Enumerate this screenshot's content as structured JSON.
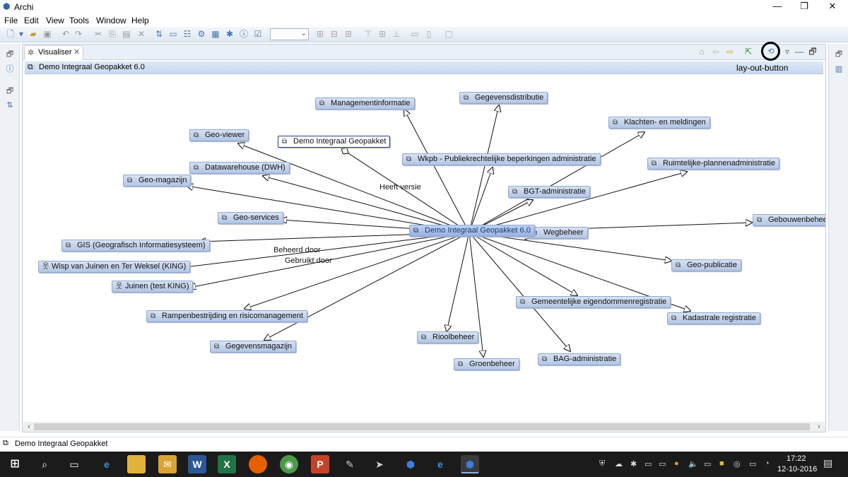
{
  "window": {
    "title": "Archi",
    "min_icon": "minimize-icon",
    "max_icon": "restore-icon",
    "close_icon": "close-icon"
  },
  "menu": [
    "File",
    "Edit",
    "View",
    "Tools",
    "Window",
    "Help"
  ],
  "toolbar": {
    "icons": [
      "new-icon",
      "open-icon",
      "save-icon",
      "undo-icon",
      "redo-icon",
      "cut-icon",
      "copy-icon",
      "paste-icon",
      "delete-icon",
      "model-tree-icon",
      "properties-icon",
      "outline-icon",
      "navigator-icon",
      "palette-icon",
      "info-icon",
      "validate-icon",
      "zoom-combo",
      "align-left-icon",
      "align-center-icon",
      "align-right-icon",
      "align-top-icon",
      "align-middle-icon",
      "align-bottom-icon",
      "match-width-icon",
      "match-height-icon",
      "fullscreen-icon"
    ]
  },
  "view": {
    "tab_label": "Visualiser",
    "breadcrumb": "Demo Integraal Geopakket 6.0",
    "annotation": "lay-out-button",
    "toolbar_icons": [
      "home-icon",
      "back-icon",
      "forward-icon",
      "drill-icon",
      "layout-icon",
      "view-menu-icon",
      "minimize-view-icon",
      "maximize-view-icon"
    ]
  },
  "graph": {
    "center": "Demo Integraal Geopakket 6.0",
    "focus_node": "Demo Integraal Geopakket",
    "nodes": [
      "Managementinformatie",
      "Gegevensdistributie",
      "Klachten- en meldingen",
      "Geo-viewer",
      "Demo Integraal Geopakket",
      "Wkpb - Publiekrechtelijke beperkingen administratie",
      "Ruimtelijke-plannenadministratie",
      "Datawarehouse (DWH)",
      "Geo-magazijn",
      "BGT-administratie",
      "Geo-services",
      "Gebouwenbeheer",
      "Wegbeheer",
      "GIS (Geografisch Informatiesysteem)",
      "Wisp van Juinen en Ter Weksel (KING)",
      "Juinen (test KING)",
      "Geo-publicatie",
      "Rampenbestrijding en risicomanagement",
      "Gemeentelijke eigendommenregistratie",
      "Kadastrale registratie",
      "Gegevensmagazijn",
      "Rioolbeheer",
      "BAG-administratie",
      "Groenbeheer"
    ],
    "edge_labels": [
      "Heeft versie",
      "Beheerd door",
      "Gebruikt door"
    ]
  },
  "status": {
    "text": "Demo Integraal Geopakket"
  },
  "taskbar": {
    "apps": [
      "windows-start-icon",
      "search-icon",
      "task-view-icon",
      "edge-icon",
      "file-explorer-icon",
      "outlook-icon",
      "word-icon",
      "excel-icon",
      "firefox-icon",
      "chrome-icon",
      "powerpoint-icon",
      "paint-icon",
      "tool-icon",
      "archi-icon",
      "ie-icon",
      "archi-active-icon"
    ],
    "time": "17:22",
    "date": "12-10-2016"
  }
}
